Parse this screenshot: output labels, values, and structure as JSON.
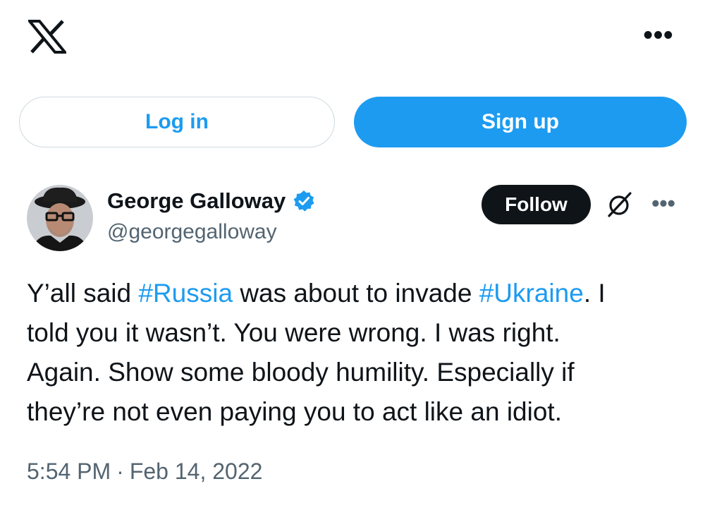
{
  "header": {
    "logo_icon": "x-logo-icon",
    "more_icon": "more-horizontal-icon",
    "more_label": "•••"
  },
  "auth": {
    "login_label": "Log in",
    "signup_label": "Sign up"
  },
  "tweet": {
    "author": {
      "name": "George Galloway",
      "handle": "@georgegalloway",
      "verified": true
    },
    "follow_label": "Follow",
    "more_label": "•••",
    "text_lines": [
      {
        "pre": "Y’all said ",
        "tag1": "#Russia",
        "mid": " was about to invade ",
        "tag2": "#Ukraine",
        "post": ". I"
      },
      {
        "text": "told you it wasn’t. You were wrong. I was right."
      },
      {
        "text": "Again. Show some bloody humility. Especially if"
      },
      {
        "text": "they’re not even paying you to act like an idiot."
      }
    ],
    "time": "5:54 PM",
    "separator": "·",
    "date": "Feb 14, 2022"
  },
  "colors": {
    "accent": "#1d9bf0",
    "text": "#0f1419",
    "secondary": "#536471",
    "follow_bg": "#0f1419"
  }
}
